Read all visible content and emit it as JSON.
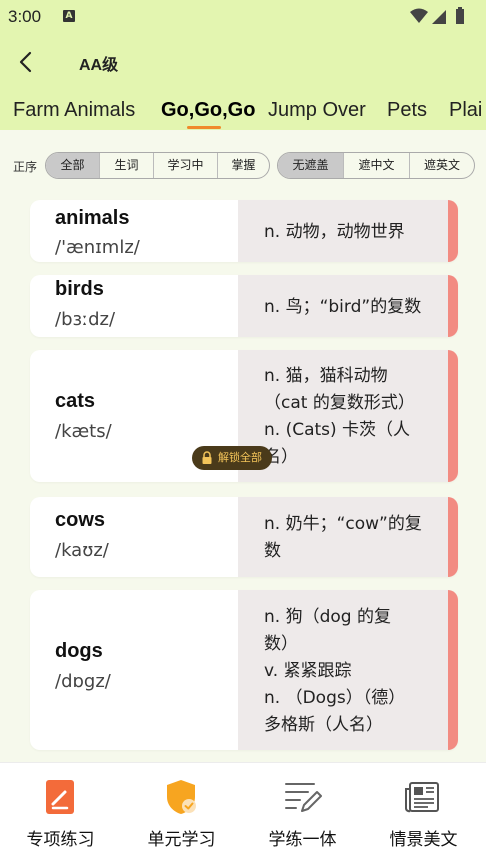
{
  "status_bar": {
    "time": "3:00",
    "notification_icon": "A"
  },
  "app_bar": {
    "title": "AA级",
    "back_icon": "chevron-left-icon"
  },
  "tabs": [
    {
      "label": "Farm Animals",
      "active": false
    },
    {
      "label": "Go,Go,Go",
      "active": true
    },
    {
      "label": "Jump Over",
      "active": false
    },
    {
      "label": "Pets",
      "active": false
    },
    {
      "label": "Plai",
      "active": false
    }
  ],
  "filters": {
    "order_label": "正序",
    "scope": [
      {
        "label": "全部",
        "selected": true
      },
      {
        "label": "生词",
        "selected": false
      },
      {
        "label": "学习中",
        "selected": false
      },
      {
        "label": "掌握",
        "selected": false
      }
    ],
    "mask": [
      {
        "label": "无遮盖",
        "selected": true
      },
      {
        "label": "遮中文",
        "selected": false
      },
      {
        "label": "遮英文",
        "selected": false
      }
    ]
  },
  "words": [
    {
      "word": "animals",
      "phonetic": "/'ænɪmlz/",
      "meaning": "n. 动物，动物世界"
    },
    {
      "word": "birds",
      "phonetic": "/bɜːdz/",
      "meaning": "n. 鸟；“bird”的复数"
    },
    {
      "word": "cats",
      "phonetic": "/kæts/",
      "meaning": "n. 猫，猫科动物\n（cat 的复数形式）\nn. (Cats) 卡茨（人\n名）"
    },
    {
      "word": "cows",
      "phonetic": "/kaʊz/",
      "meaning": "n. 奶牛；“cow”的复\n数"
    },
    {
      "word": "dogs",
      "phonetic": "/dɒgz/",
      "meaning": "n. 狗（dog 的复\n数）\nv. 紧紧跟踪\nn. （Dogs）（德）\n多格斯（人名）"
    }
  ],
  "unlock_badge": "解锁全部",
  "bottom_nav": [
    {
      "label": "专项练习",
      "icon": "pen-document-icon"
    },
    {
      "label": "单元学习",
      "icon": "shield-check-icon"
    },
    {
      "label": "学练一体",
      "icon": "edit-lines-icon"
    },
    {
      "label": "情景美文",
      "icon": "newspaper-icon"
    }
  ],
  "colors": {
    "header_bg": "#e3f5b0",
    "accent_orange": "#f08a2a",
    "stripe_red": "#f28b82"
  }
}
